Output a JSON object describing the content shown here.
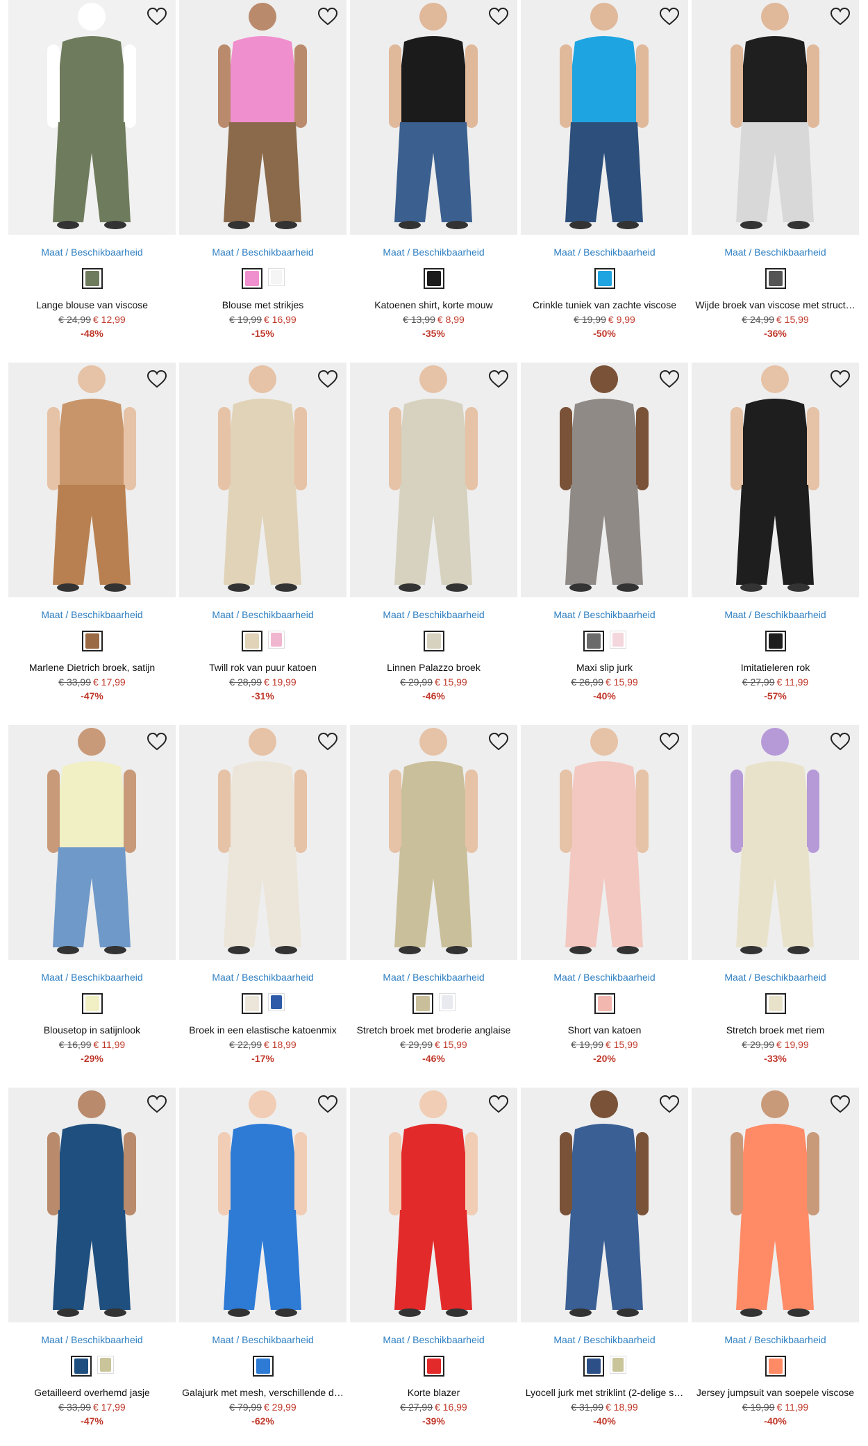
{
  "common": {
    "maat_label": "Maat / Beschikbaarheid"
  },
  "products": [
    {
      "title": "Lange blouse van viscose",
      "old_price": "€ 24,99",
      "new_price": "€ 12,99",
      "discount": "-48%",
      "bg": "#f1f1f1",
      "garment": "#6e7b5c",
      "skin": "#ffffff",
      "lower": "#6e7b5c",
      "swatches": [
        {
          "color": "#6e7b5c",
          "selected": true
        }
      ]
    },
    {
      "title": "Blouse met strikjes",
      "old_price": "€ 19,99",
      "new_price": "€ 16,99",
      "discount": "-15%",
      "bg": "#eeeeee",
      "garment": "#f08fce",
      "skin": "#b98a6c",
      "lower": "#8a6a4a",
      "swatches": [
        {
          "color": "#f08fce",
          "selected": true
        },
        {
          "color": "#f5f5f5",
          "selected": false
        }
      ]
    },
    {
      "title": "Katoenen shirt, korte mouw",
      "old_price": "€ 13,99",
      "new_price": "€ 8,99",
      "discount": "-35%",
      "bg": "#eeeeee",
      "garment": "#1b1b1b",
      "skin": "#e0b89a",
      "lower": "#3b5f8e",
      "swatches": [
        {
          "color": "#1b1b1b",
          "selected": true
        }
      ]
    },
    {
      "title": "Crinkle tuniek van zachte viscose",
      "old_price": "€ 19,99",
      "new_price": "€ 9,99",
      "discount": "-50%",
      "bg": "#eeeeee",
      "garment": "#1ea4e0",
      "skin": "#e0b89a",
      "lower": "#2d4f7c",
      "swatches": [
        {
          "color": "#1ea4e0",
          "selected": true
        }
      ]
    },
    {
      "title": "Wijde broek van viscose met struct…",
      "old_price": "€ 24,99",
      "new_price": "€ 15,99",
      "discount": "-36%",
      "bg": "#eeeeee",
      "garment": "#1f1f1f",
      "skin": "#e0b89a",
      "lower": "#d8d8d8",
      "swatches": [
        {
          "color": "#555555",
          "selected": true
        }
      ]
    },
    {
      "title": "Marlene Dietrich broek, satijn",
      "old_price": "€ 33,99",
      "new_price": "€ 17,99",
      "discount": "-47%",
      "bg": "#eeeeee",
      "garment": "#c8956a",
      "skin": "#e6c2a6",
      "lower": "#b88050",
      "swatches": [
        {
          "color": "#9a6a44",
          "selected": true
        }
      ]
    },
    {
      "title": "Twill rok van puur katoen",
      "old_price": "€ 28,99",
      "new_price": "€ 19,99",
      "discount": "-31%",
      "bg": "#eeeeee",
      "garment": "#e0d3b8",
      "skin": "#e6c2a6",
      "lower": "#e0d3b8",
      "swatches": [
        {
          "color": "#e0d3b8",
          "selected": true
        },
        {
          "color": "#f1b6cf",
          "selected": false
        }
      ]
    },
    {
      "title": "Linnen Palazzo broek",
      "old_price": "€ 29,99",
      "new_price": "€ 15,99",
      "discount": "-46%",
      "bg": "#eeeeee",
      "garment": "#d6d2bf",
      "skin": "#e6c2a6",
      "lower": "#d6d2bf",
      "swatches": [
        {
          "color": "#d6d2bf",
          "selected": true
        }
      ]
    },
    {
      "title": "Maxi slip jurk",
      "old_price": "€ 26,99",
      "new_price": "€ 15,99",
      "discount": "-40%",
      "bg": "#eeeeee",
      "garment": "#8f8a86",
      "skin": "#7a5238",
      "lower": "#8f8a86",
      "swatches": [
        {
          "color": "#6b6b6b",
          "selected": true
        },
        {
          "color": "#f4d7dd",
          "selected": false
        }
      ]
    },
    {
      "title": "Imitatieleren rok",
      "old_price": "€ 27,99",
      "new_price": "€ 11,99",
      "discount": "-57%",
      "bg": "#eeeeee",
      "garment": "#1e1e1e",
      "skin": "#e6c2a6",
      "lower": "#1e1e1e",
      "swatches": [
        {
          "color": "#1e1e1e",
          "selected": true
        }
      ]
    },
    {
      "title": "Blousetop in satijnlook",
      "old_price": "€ 16,99",
      "new_price": "€ 11,99",
      "discount": "-29%",
      "bg": "#eeeeee",
      "garment": "#f1efc4",
      "skin": "#c99a7a",
      "lower": "#6f99c8",
      "swatches": [
        {
          "color": "#f1efc4",
          "selected": true
        }
      ]
    },
    {
      "title": "Broek in een elastische katoenmix",
      "old_price": "€ 22,99",
      "new_price": "€ 18,99",
      "discount": "-17%",
      "bg": "#eeeeee",
      "garment": "#ece6da",
      "skin": "#e6c2a6",
      "lower": "#ece6da",
      "swatches": [
        {
          "color": "#ece6da",
          "selected": true
        },
        {
          "color": "#2e5aa8",
          "selected": false
        }
      ]
    },
    {
      "title": "Stretch broek met broderie anglaise",
      "old_price": "€ 29,99",
      "new_price": "€ 15,99",
      "discount": "-46%",
      "bg": "#eeeeee",
      "garment": "#c9bf9a",
      "skin": "#e6c2a6",
      "lower": "#c9bf9a",
      "swatches": [
        {
          "color": "#c9bf9a",
          "selected": true
        },
        {
          "color": "#e8eaf0",
          "selected": false
        }
      ]
    },
    {
      "title": "Short van katoen",
      "old_price": "€ 19,99",
      "new_price": "€ 15,99",
      "discount": "-20%",
      "bg": "#eeeeee",
      "garment": "#f2c8c0",
      "skin": "#e6c2a6",
      "lower": "#f2c8c0",
      "swatches": [
        {
          "color": "#f2b8b0",
          "selected": true
        }
      ]
    },
    {
      "title": "Stretch broek met riem",
      "old_price": "€ 29,99",
      "new_price": "€ 19,99",
      "discount": "-33%",
      "bg": "#eeeeee",
      "garment": "#e9e2cb",
      "skin": "#b69ad8",
      "lower": "#e9e2cb",
      "swatches": [
        {
          "color": "#e9e2cb",
          "selected": true
        }
      ]
    },
    {
      "title": "Getailleerd overhemd jasje",
      "old_price": "€ 33,99",
      "new_price": "€ 17,99",
      "discount": "-47%",
      "bg": "#eeeeee",
      "garment": "#1f4f7e",
      "skin": "#b98a6c",
      "lower": "#1f4f7e",
      "swatches": [
        {
          "color": "#1f4f7e",
          "selected": true
        },
        {
          "color": "#c9c49a",
          "selected": false
        }
      ]
    },
    {
      "title": "Galajurk met mesh, verschillende d…",
      "old_price": "€ 79,99",
      "new_price": "€ 29,99",
      "discount": "-62%",
      "bg": "#eeeeee",
      "garment": "#2e7bd6",
      "skin": "#f0cdb4",
      "lower": "#2e7bd6",
      "swatches": [
        {
          "color": "#2e7bd6",
          "selected": true
        }
      ]
    },
    {
      "title": "Korte blazer",
      "old_price": "€ 27,99",
      "new_price": "€ 16,99",
      "discount": "-39%",
      "bg": "#eeeeee",
      "garment": "#e32a2a",
      "skin": "#f0cdb4",
      "lower": "#e32a2a",
      "swatches": [
        {
          "color": "#e32a2a",
          "selected": true
        }
      ]
    },
    {
      "title": "Lyocell jurk met striklint (2-delige s…",
      "old_price": "€ 31,99",
      "new_price": "€ 18,99",
      "discount": "-40%",
      "bg": "#eeeeee",
      "garment": "#3a5f94",
      "skin": "#7a5238",
      "lower": "#3a5f94",
      "swatches": [
        {
          "color": "#2b4f86",
          "selected": true
        },
        {
          "color": "#c9c49a",
          "selected": false
        }
      ]
    },
    {
      "title": "Jersey jumpsuit van soepele viscose",
      "old_price": "€ 19,99",
      "new_price": "€ 11,99",
      "discount": "-40%",
      "bg": "#eeeeee",
      "garment": "#ff8a66",
      "skin": "#c99a7a",
      "lower": "#ff8a66",
      "swatches": [
        {
          "color": "#ff8a66",
          "selected": true
        }
      ]
    }
  ]
}
